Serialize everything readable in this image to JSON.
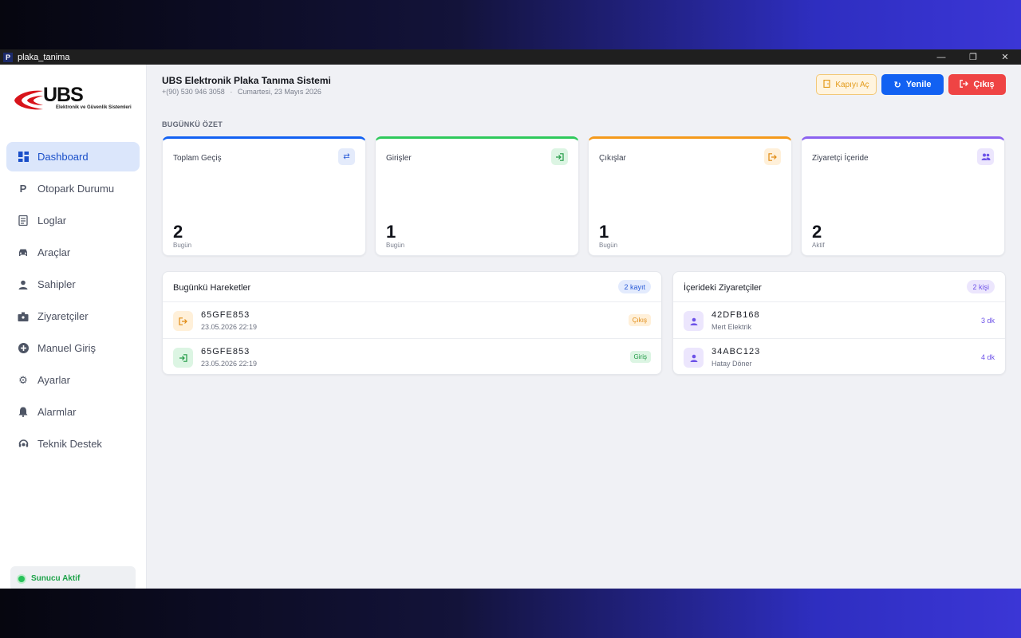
{
  "window": {
    "title": "plaka_tanima",
    "app_icon_letter": "P"
  },
  "logo": {
    "brand": "UBS",
    "subtitle": "Elektronik ve Güvenlik Sistemleri"
  },
  "sidebar": {
    "items": [
      {
        "label": "Dashboard",
        "icon": "dashboard-icon",
        "active": true
      },
      {
        "label": "Otopark Durumu",
        "icon": "parking-icon"
      },
      {
        "label": "Loglar",
        "icon": "log-icon"
      },
      {
        "label": "Araçlar",
        "icon": "car-icon"
      },
      {
        "label": "Sahipler",
        "icon": "person-icon"
      },
      {
        "label": "Ziyaretçiler",
        "icon": "badge-icon"
      },
      {
        "label": "Manuel Giriş",
        "icon": "plus-circle-icon"
      },
      {
        "label": "Ayarlar",
        "icon": "gear-icon"
      },
      {
        "label": "Alarmlar",
        "icon": "bell-icon"
      },
      {
        "label": "Teknik Destek",
        "icon": "support-icon"
      }
    ],
    "server_status": "Sunucu Aktif"
  },
  "header": {
    "title": "UBS Elektronik Plaka Tanıma Sistemi",
    "phone": "+(90) 530 946 3058",
    "separator": "·",
    "date": "Cumartesi, 23 Mayıs 2026",
    "buttons": {
      "door": "Kapıyı Aç",
      "refresh": "Yenile",
      "exit": "Çıkış"
    }
  },
  "summary": {
    "section_title": "BUGÜNKÜ ÖZET",
    "cards": [
      {
        "label": "Toplam Geçiş",
        "value": "2",
        "caption": "Bugün",
        "color": "#1261f2",
        "icon": "swap-icon"
      },
      {
        "label": "Girişler",
        "value": "1",
        "caption": "Bugün",
        "color": "#2fc95c",
        "icon": "entry-icon"
      },
      {
        "label": "Çıkışlar",
        "value": "1",
        "caption": "Bugün",
        "color": "#f59a1b",
        "icon": "exit-icon"
      },
      {
        "label": "Ziyaretçi İçeride",
        "value": "2",
        "caption": "Aktif",
        "color": "#8b62f0",
        "icon": "group-icon"
      }
    ]
  },
  "movements": {
    "title": "Bugünkü Hareketler",
    "badge": "2 kayıt",
    "rows": [
      {
        "plate": "65GFE853",
        "time": "23.05.2026 22:19",
        "type": "Çıkış"
      },
      {
        "plate": "65GFE853",
        "time": "23.05.2026 22:19",
        "type": "Giriş"
      }
    ]
  },
  "visitors": {
    "title": "İçerideki Ziyaretçiler",
    "badge": "2 kişi",
    "rows": [
      {
        "plate": "42DFB168",
        "name": "Mert Elektrik",
        "duration": "3 dk"
      },
      {
        "plate": "34ABC123",
        "name": "Hatay Döner",
        "duration": "4 dk"
      }
    ]
  }
}
